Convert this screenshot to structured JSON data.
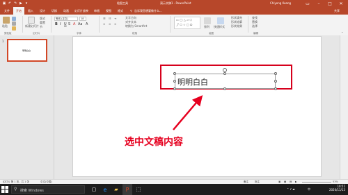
{
  "window": {
    "title": "演示文稿1 - PowerPoint",
    "context_tab_group": "绘图工具",
    "user": "Chiyong Kuang",
    "colors": {
      "accent": "#b7472a",
      "selection_red": "#d6001c",
      "annotation_red": "#e6001f"
    }
  },
  "quick_access": {
    "save_icon": "save-icon",
    "undo_icon": "undo-icon",
    "redo_icon": "redo-icon",
    "present_icon": "slideshow-icon",
    "more_icon": "customize-icon"
  },
  "tabs": [
    {
      "label": "文件",
      "active": false
    },
    {
      "label": "开始",
      "active": true
    },
    {
      "label": "插入",
      "active": false
    },
    {
      "label": "设计",
      "active": false
    },
    {
      "label": "切换",
      "active": false
    },
    {
      "label": "动画",
      "active": false
    },
    {
      "label": "幻灯片放映",
      "active": false
    },
    {
      "label": "审阅",
      "active": false
    },
    {
      "label": "视图",
      "active": false
    },
    {
      "label": "格式",
      "active": false
    }
  ],
  "tellme": {
    "text": "告诉我您想要做什么..."
  },
  "share": {
    "label": "共享"
  },
  "ribbon": {
    "groups": [
      {
        "label": "剪贴板"
      },
      {
        "label": "幻灯片"
      },
      {
        "label": "字体"
      },
      {
        "label": "段落"
      },
      {
        "label": "绘图"
      },
      {
        "label": "编辑"
      }
    ],
    "buttons": {
      "paste": "粘贴",
      "new_slide": "新建幻灯片",
      "layout": "版式",
      "reset": "重置",
      "section": "节",
      "font_name": "等线 (正文)",
      "font_size": "18",
      "text_direction": "文字方向",
      "align_text": "对齐文本",
      "smartart": "转换为 SmartArt",
      "arrange": "排列",
      "quick_styles": "快速样式",
      "shape_fill": "形状填充",
      "shape_outline": "形状轮廓",
      "shape_effects": "形状效果",
      "find": "查找",
      "replace": "替换",
      "select": "选择"
    }
  },
  "slides_panel": {
    "slide_number": "1"
  },
  "slide": {
    "textbox_text": "明明白白"
  },
  "annotation": {
    "text": "选中文稿内容"
  },
  "status": {
    "slide_info": "幻灯片 第 1 张，共 1 张",
    "language": "中文(中国)",
    "notes": "备注",
    "comments": "批注",
    "zoom": "53%"
  },
  "taskbar": {
    "search_placeholder": "搜索 Windows",
    "time": "10:51",
    "date": "2020/11/13",
    "ime": "中"
  }
}
